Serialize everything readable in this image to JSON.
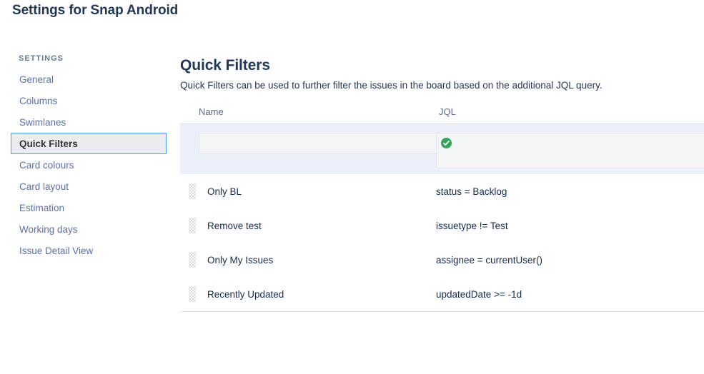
{
  "page": {
    "title": "Settings for Snap Android"
  },
  "sidebar": {
    "heading": "SETTINGS",
    "items": [
      {
        "label": "General",
        "selected": false
      },
      {
        "label": "Columns",
        "selected": false
      },
      {
        "label": "Swimlanes",
        "selected": false
      },
      {
        "label": "Quick Filters",
        "selected": true
      },
      {
        "label": "Card colours",
        "selected": false
      },
      {
        "label": "Card layout",
        "selected": false
      },
      {
        "label": "Estimation",
        "selected": false
      },
      {
        "label": "Working days",
        "selected": false
      },
      {
        "label": "Issue Detail View",
        "selected": false
      }
    ]
  },
  "main": {
    "section_title": "Quick Filters",
    "section_desc": "Quick Filters can be used to further filter the issues in the board based on the additional JQL query.",
    "table": {
      "headers": {
        "name": "Name",
        "jql": "JQL"
      },
      "new_row": {
        "name_value": "",
        "name_placeholder": "",
        "jql_value": "",
        "jql_placeholder": "",
        "validation_icon": "check-circle-icon",
        "validation_color": "#36A35B"
      },
      "rows": [
        {
          "handle": "drag-handle-icon",
          "name": "Only BL",
          "jql": "status = Backlog"
        },
        {
          "handle": "drag-handle-icon",
          "name": "Remove test",
          "jql": "issuetype != Test"
        },
        {
          "handle": "drag-handle-icon",
          "name": "Only My Issues",
          "jql": "assignee = currentUser()"
        },
        {
          "handle": "drag-handle-icon",
          "name": "Recently Updated",
          "jql": "updatedDate >= -1d"
        }
      ]
    }
  },
  "colors": {
    "title": "#243757",
    "link": "#5d6fa5",
    "selected_border": "#4C9AFF",
    "selected_bg": "#EBECF0",
    "form_row_bg": "#EAEFF9",
    "success": "#36A35B",
    "border": "#DFE1E6"
  }
}
